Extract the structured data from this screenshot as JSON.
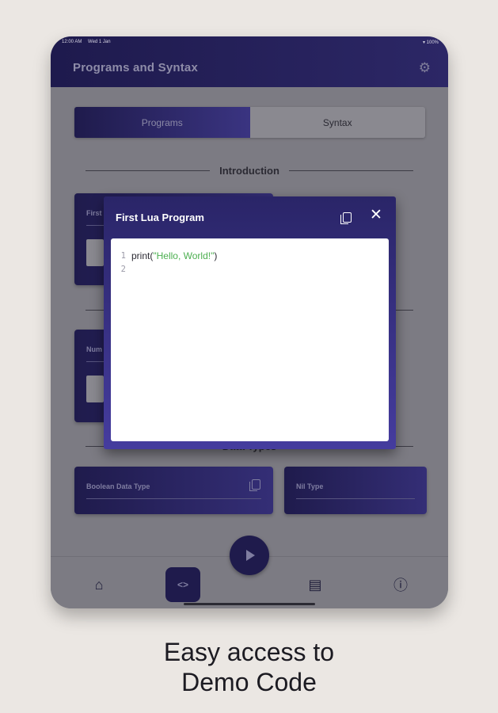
{
  "status_bar": {
    "time": "12:00 AM",
    "date": "Wed 1 Jan",
    "battery": "100%"
  },
  "app_bar": {
    "title": "Programs and Syntax",
    "settings_icon": "gear-icon"
  },
  "segments": {
    "programs": "Programs",
    "syntax": "Syntax"
  },
  "sections": {
    "introduction": "Introduction",
    "data_types": "Data Types"
  },
  "cards": {
    "first_card_title": "First",
    "numbers_card_title": "Num",
    "boolean_card_title": "Boolean Data Type",
    "nil_card_title": "Nil Type"
  },
  "dialog": {
    "title": "First Lua Program",
    "copy_icon": "copy-icon",
    "close_icon": "close-icon",
    "code": {
      "line1_number": "1",
      "line1_fn": "print(",
      "line1_str": "\"Hello, World!\"",
      "line1_end": ")",
      "line2_number": "2"
    }
  },
  "nav": {
    "home_icon": "home-icon",
    "code_icon": "code-icon",
    "code_label": "<>",
    "play_icon": "play-icon",
    "chat_icon": "chat-icon",
    "help_icon": "help-icon"
  },
  "caption": {
    "line1": "Easy access to",
    "line2": "Demo Code"
  },
  "colors": {
    "accent": "#2a2568",
    "dialog_gradient_end": "#453c9e",
    "string_green": "#4caf50",
    "backdrop": "#ebe7e3"
  }
}
